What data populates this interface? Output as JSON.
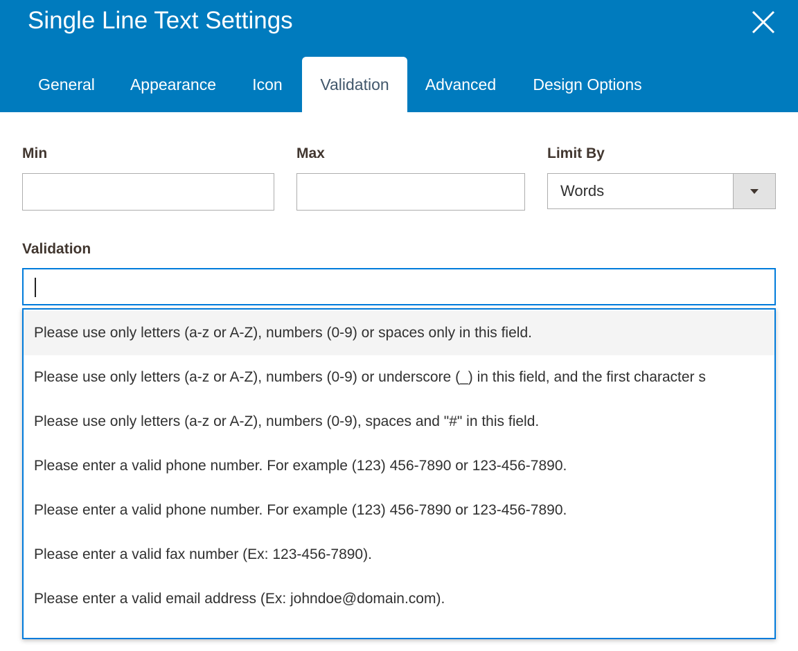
{
  "dialog": {
    "title": "Single Line Text Settings",
    "close_icon": "close-icon"
  },
  "tabs": [
    {
      "label": "General"
    },
    {
      "label": "Appearance"
    },
    {
      "label": "Icon"
    },
    {
      "label": "Validation",
      "active": true
    },
    {
      "label": "Advanced"
    },
    {
      "label": "Design Options"
    }
  ],
  "form": {
    "min_label": "Min",
    "min_value": "",
    "max_label": "Max",
    "max_value": "",
    "limit_by_label": "Limit By",
    "limit_by_value": "Words",
    "validation_label": "Validation",
    "validation_value": ""
  },
  "validation_options": [
    "Please use only letters (a-z or A-Z), numbers (0-9) or spaces only in this field.",
    "Please use only letters (a-z or A-Z), numbers (0-9) or underscore (_) in this field, and the first character s",
    "Please use only letters (a-z or A-Z), numbers (0-9), spaces and \"#\" in this field.",
    "Please enter a valid phone number. For example (123) 456-7890 or 123-456-7890.",
    "Please enter a valid phone number. For example (123) 456-7890 or 123-456-7890.",
    "Please enter a valid fax number (Ex: 123-456-7890).",
    "Please enter a valid email address (Ex: johndoe@domain.com)."
  ],
  "colors": {
    "header": "#007bbe",
    "focus_border": "#007bdb",
    "label": "#41362f"
  }
}
